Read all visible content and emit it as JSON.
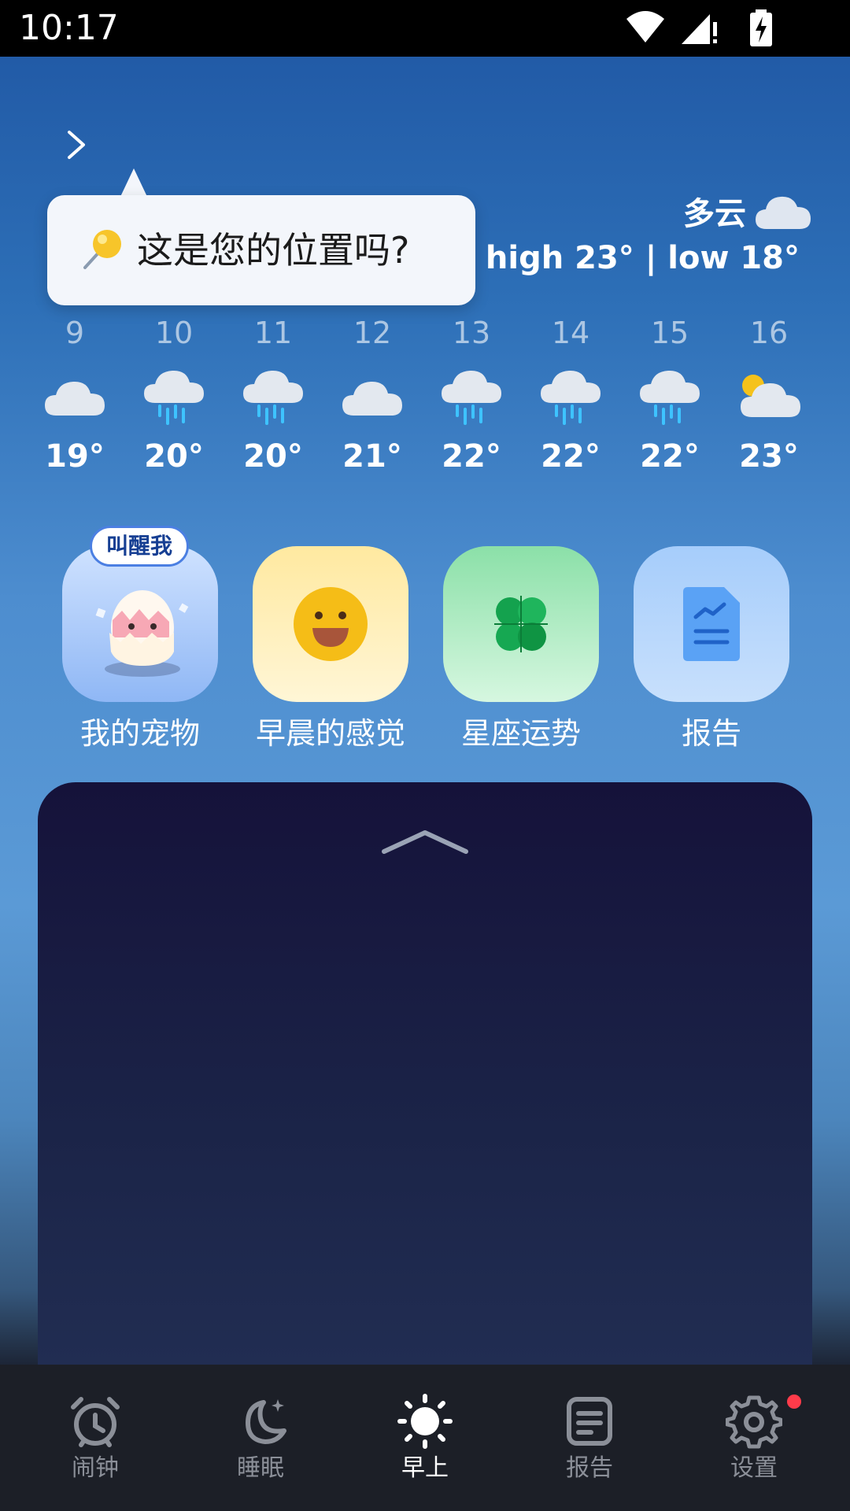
{
  "status_bar": {
    "time": "10:17"
  },
  "header": {
    "weather_condition": "多云",
    "high_low": "high 23° | low 18°"
  },
  "tooltip": {
    "text": "这是您的位置吗?"
  },
  "hourly": [
    {
      "hour": "9",
      "temp": "19°",
      "icon": "cloud-icon"
    },
    {
      "hour": "10",
      "temp": "20°",
      "icon": "rain-icon"
    },
    {
      "hour": "11",
      "temp": "20°",
      "icon": "rain-icon"
    },
    {
      "hour": "12",
      "temp": "21°",
      "icon": "cloud-icon"
    },
    {
      "hour": "13",
      "temp": "22°",
      "icon": "rain-icon"
    },
    {
      "hour": "14",
      "temp": "22°",
      "icon": "rain-icon"
    },
    {
      "hour": "15",
      "temp": "22°",
      "icon": "rain-icon"
    },
    {
      "hour": "16",
      "temp": "23°",
      "icon": "partly-sunny-icon"
    }
  ],
  "features": [
    {
      "label": "我的宠物",
      "badge": "叫醒我",
      "icon": "pet-egg-icon"
    },
    {
      "label": "早晨的感觉",
      "icon": "smiley-icon"
    },
    {
      "label": "星座运势",
      "icon": "clover-icon"
    },
    {
      "label": "报告",
      "icon": "report-icon"
    }
  ],
  "nav": [
    {
      "label": "闹钟",
      "icon": "alarm-clock-icon",
      "active": false
    },
    {
      "label": "睡眠",
      "icon": "moon-icon",
      "active": false
    },
    {
      "label": "早上",
      "icon": "sun-icon",
      "active": true
    },
    {
      "label": "报告",
      "icon": "report-icon",
      "active": false
    },
    {
      "label": "设置",
      "icon": "gear-icon",
      "active": false
    }
  ],
  "colors": {
    "accent_dot": "#ff3b4a",
    "nav_active": "#ffffff",
    "nav_inactive": "#8b8f98"
  }
}
